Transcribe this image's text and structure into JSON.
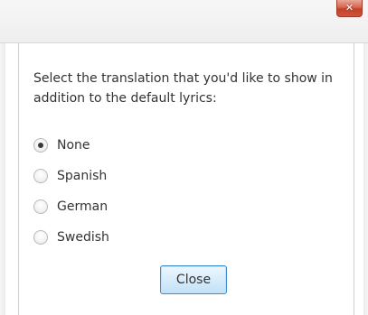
{
  "window": {
    "close_glyph": "✕"
  },
  "dialog": {
    "prompt": "Select the translation that you'd like to show in addition to the default lyrics:",
    "options": [
      {
        "label": "None",
        "selected": true
      },
      {
        "label": "Spanish",
        "selected": false
      },
      {
        "label": "German",
        "selected": false
      },
      {
        "label": "Swedish",
        "selected": false
      }
    ],
    "close_label": "Close"
  },
  "colors": {
    "close_button_border": "#3d8fd2",
    "window_close_red": "#d0523a"
  }
}
